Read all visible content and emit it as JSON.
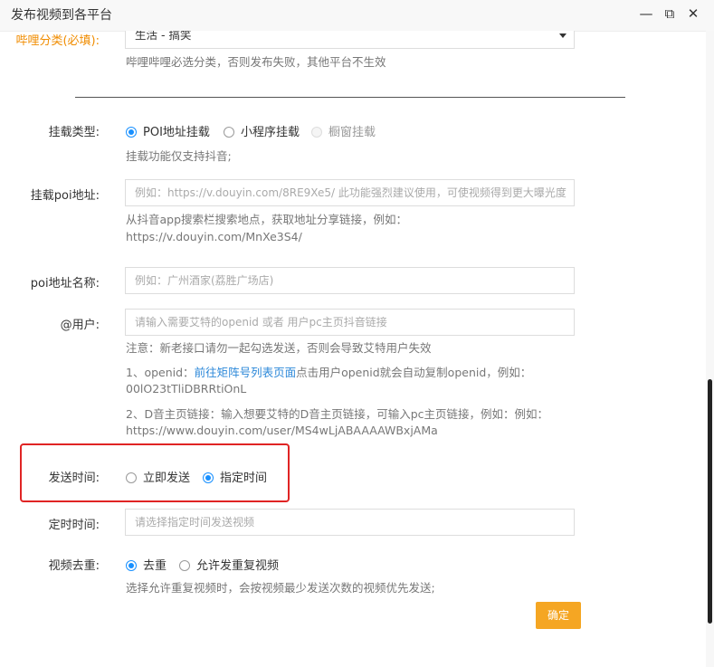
{
  "window": {
    "title": "发布视频到各平台"
  },
  "bilibili_category": {
    "label": "哔哩分类(必填):",
    "value": "生活 - 搞笑",
    "hint": "哔哩哔哩必选分类，否则发布失败，其他平台不生效"
  },
  "mount_type": {
    "label": "挂载类型:",
    "options": [
      "POI地址挂载",
      "小程序挂载",
      "橱窗挂载"
    ],
    "selected": "POI地址挂载",
    "hint": "挂载功能仅支持抖音;"
  },
  "poi_address": {
    "label": "挂载poi地址:",
    "placeholder": "例如：https://v.douyin.com/8RE9Xe5/  此功能强烈建议使用，可使视频得到更大曝光度",
    "hint_line1": "从抖音app搜索栏搜索地点，获取地址分享链接，例如：",
    "hint_line2": "https://v.douyin.com/MnXe3S4/"
  },
  "poi_name": {
    "label": "poi地址名称:",
    "placeholder": "例如：广州酒家(荔胜广场店)"
  },
  "at_user": {
    "label": "@用户:",
    "placeholder": "请输入需要艾特的openid 或者 用户pc主页抖音链接",
    "note": "注意：新老接口请勿一起勾选发送，否则会导致艾特用户失效",
    "openid_prefix": "1、openid：",
    "openid_link": "前往矩阵号列表页面",
    "openid_suffix": "点击用户openid就会自动复制openid，例如：",
    "openid_example": "00lO23tTliDBRRtiOnL",
    "dlink_text": "2、D音主页链接：输入想要艾特的D音主页链接，可输入pc主页链接，例如：例如：",
    "dlink_example": "https://www.douyin.com/user/MS4wLjABAAAAWBxjAMa"
  },
  "send_time": {
    "label": "发送时间:",
    "options": [
      "立即发送",
      "指定时间"
    ],
    "selected": "指定时间"
  },
  "scheduled_time": {
    "label": "定时时间:",
    "placeholder": "请选择指定时间发送视频"
  },
  "dedupe": {
    "label": "视频去重:",
    "options": [
      "去重",
      "允许发重复视频"
    ],
    "selected": "去重",
    "hint": "选择允许重复视频时，会按视频最少发送次数的视频优先发送;"
  },
  "confirm_button": "确定",
  "colors": {
    "accent": "#f5a623",
    "radio": "#1890ff",
    "link": "#2c88d9",
    "highlight": "#e02424"
  }
}
